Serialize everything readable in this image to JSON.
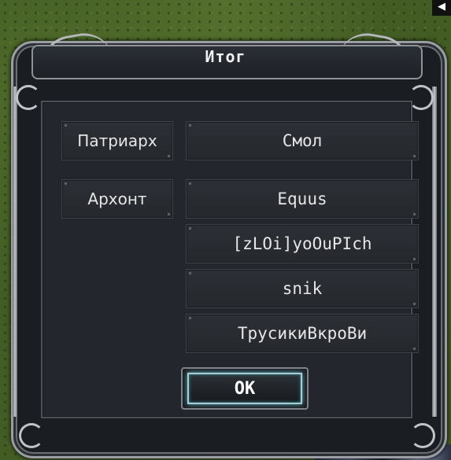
{
  "dialog": {
    "title": "Итог",
    "rows": [
      {
        "label": "Патриарх",
        "values": [
          "Смол"
        ]
      },
      {
        "label": "Архонт",
        "values": [
          "Equus",
          "[zLOi]yoOuPIch",
          "snik",
          "ТрусикиВкроВи"
        ]
      }
    ],
    "ok_label": "OK"
  },
  "corner_indicator": "◀"
}
